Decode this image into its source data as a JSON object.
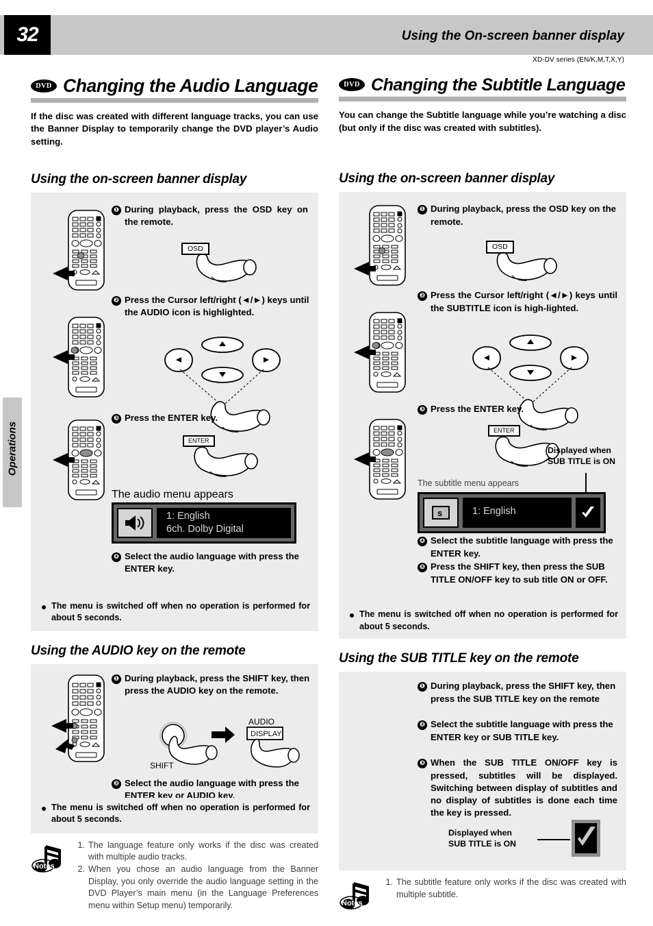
{
  "header": {
    "page_number": "32",
    "title": "Using the On-screen banner display",
    "series": "XD-DV series (EN/K,M,T,X,Y)"
  },
  "side_tab": {
    "label": "Operations"
  },
  "left": {
    "badge": "DVD",
    "title": "Changing the Audio Language",
    "intro": "If the disc was created with different language tracks, you can use the Banner Display to temporarily change the DVD player’s Audio setting.",
    "subhead1": "Using the on-screen banner display",
    "steps": [
      {
        "num": "❶",
        "text": "During playback, press   the OSD key on the remote."
      },
      {
        "num": "❷",
        "text": "Press the Cursor left/right (◄/►) keys until the AUDIO icon is highlighted."
      },
      {
        "num": "❸",
        "text": "Press the ENTER key."
      },
      {
        "num": "❹",
        "text": "Select   the audio language with press the ENTER key."
      }
    ],
    "key_osd": "OSD",
    "key_enter": "ENTER",
    "menu_caption": "The audio menu appears",
    "menu": {
      "icon": "speaker-icon",
      "line1": "1: English",
      "line2": "6ch. Dolby Digital"
    },
    "bullet": "The menu is switched off when no operation is performed for about 5 seconds.",
    "subhead2": "Using the AUDIO key on the remote",
    "steps2": [
      {
        "num": "❶",
        "text": "During playback, press  the SHIFT key, then press the AUDIO key on the remote."
      },
      {
        "num": "❷",
        "text": "Select the audio language with press the ENTER key or AUDIO key."
      }
    ],
    "key_shift_label": "SHIFT",
    "key_audio_label": "AUDIO",
    "key_display": "DISPLAY",
    "bullet2": "The menu is switched off when no operation is performed for about 5 seconds.",
    "notes_label": "Notes",
    "notes": [
      {
        "n": "1.",
        "t": "The language feature only works if the disc was created with multiple audio tracks."
      },
      {
        "n": "2.",
        "t": "When you chose an audio language from the Banner Display, you only override the audio language setting in the DVD Player’s main menu (in the Language Preferences menu within Setup menu) temporarily."
      }
    ]
  },
  "right": {
    "badge": "DVD",
    "title": "Changing the Subtitle Language",
    "intro": "You can change the Subtitle language while you’re watching a disc (but only if the disc was created with subtitles).",
    "subhead1": "Using the on-screen banner display",
    "steps": [
      {
        "num": "❶",
        "text": "During playback, press   the OSD key on the remote."
      },
      {
        "num": "❷",
        "text": "Press the Cursor left/right (◄/►) keys until the SUBTITLE icon is high-lighted."
      },
      {
        "num": "❸",
        "text": "Press the ENTER key."
      },
      {
        "num": "❹",
        "text": "Select  the subtitle language with press the ENTER key."
      },
      {
        "num": "❺",
        "text": "Press the SHIFT key, then press the SUB TITLE ON/OFF key to sub title ON or OFF."
      }
    ],
    "key_osd": "OSD",
    "key_enter": "ENTER",
    "callout1": "Displayed when\nSUB TITLE is ON",
    "menu_caption": "The subtitle menu appears",
    "menu": {
      "icon": "subtitle-s-icon",
      "line1": "1: English",
      "check": "check-icon"
    },
    "bullet": "The menu is switched off when no operation is performed for about 5 seconds.",
    "subhead2": "Using the SUB TITLE key on the remote",
    "steps2": [
      {
        "num": "❶",
        "text": "During playback, press  the SHIFT key, then press  the SUB TITLE key on the remote"
      },
      {
        "num": "❷",
        "text": "Select  the subtitle language with press the ENTER key or SUB TITLE key."
      },
      {
        "num": "❸",
        "text": "When the SUB TITLE ON/OFF key is pressed, subtitles will be displayed. Switching between display of subtitles and no display of subtitles is done each time the key is pressed."
      }
    ],
    "callout2": "Displayed when\nSUB TITLE is ON",
    "notes_label": "Notes",
    "notes": [
      {
        "n": "1.",
        "t": "The subtitle feature only works if the disc was created with multiple subtitle."
      }
    ]
  },
  "colors": {
    "header_band": "#c7c7c7",
    "panel": "#ececec",
    "rule": "#b0b0b0",
    "menu_frame": "#666666"
  }
}
